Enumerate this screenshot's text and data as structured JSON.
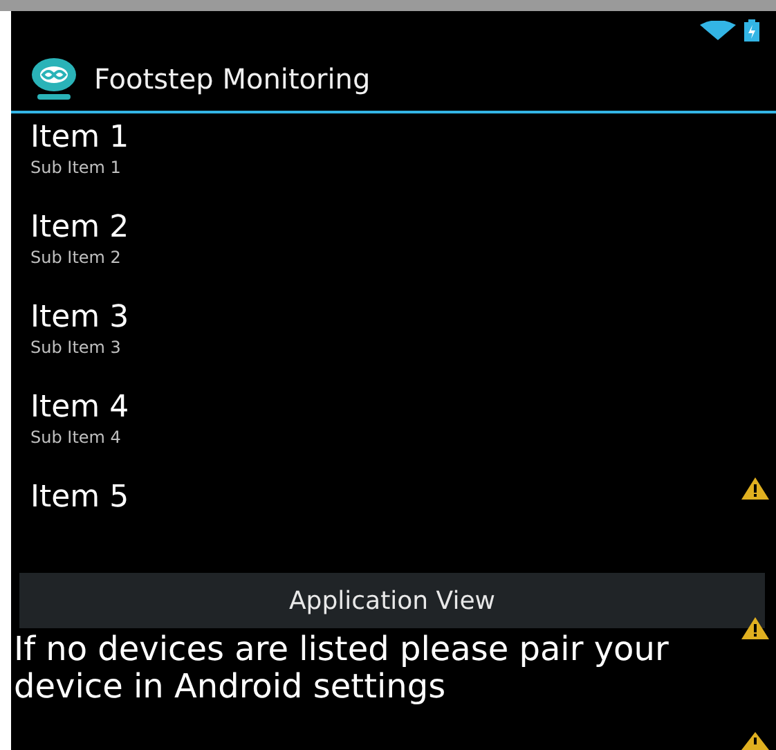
{
  "action_bar": {
    "title": "Footstep Monitoring"
  },
  "list": {
    "items": [
      {
        "title": "Item 1",
        "subtitle": "Sub Item 1"
      },
      {
        "title": "Item 2",
        "subtitle": "Sub Item 2"
      },
      {
        "title": "Item 3",
        "subtitle": "Sub Item 3"
      },
      {
        "title": "Item 4",
        "subtitle": "Sub Item 4"
      },
      {
        "title": "Item 5"
      }
    ]
  },
  "button": {
    "label": "Application View"
  },
  "message": "If no devices are listed please pair your device in Android settings"
}
